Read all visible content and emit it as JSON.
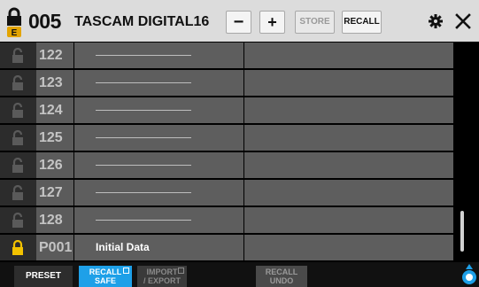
{
  "header": {
    "scene_number": "005",
    "scene_name": "TASCAM DIGITAL16",
    "protect_badge": "E",
    "minus_label": "−",
    "plus_label": "+",
    "store_label": "STORE",
    "recall_label": "RECALL"
  },
  "rows": [
    {
      "num": "122",
      "title": "",
      "locked": false
    },
    {
      "num": "123",
      "title": "",
      "locked": false
    },
    {
      "num": "124",
      "title": "",
      "locked": false
    },
    {
      "num": "125",
      "title": "",
      "locked": false
    },
    {
      "num": "126",
      "title": "",
      "locked": false
    },
    {
      "num": "127",
      "title": "",
      "locked": false
    },
    {
      "num": "128",
      "title": "",
      "locked": false
    },
    {
      "num": "P001",
      "title": "Initial Data",
      "locked": true
    }
  ],
  "bottom": {
    "preset_label": "PRESET",
    "recall_safe_line1": "RECALL",
    "recall_safe_line2": "SAFE",
    "import_line1": "IMPORT",
    "import_line2": "/ EXPORT",
    "recall_undo_line1": "RECALL",
    "recall_undo_line2": "UNDO"
  },
  "colors": {
    "accent": "#1ea0e8",
    "lock_active": "#f2c200",
    "lock_inactive": "#5a5a5a"
  }
}
